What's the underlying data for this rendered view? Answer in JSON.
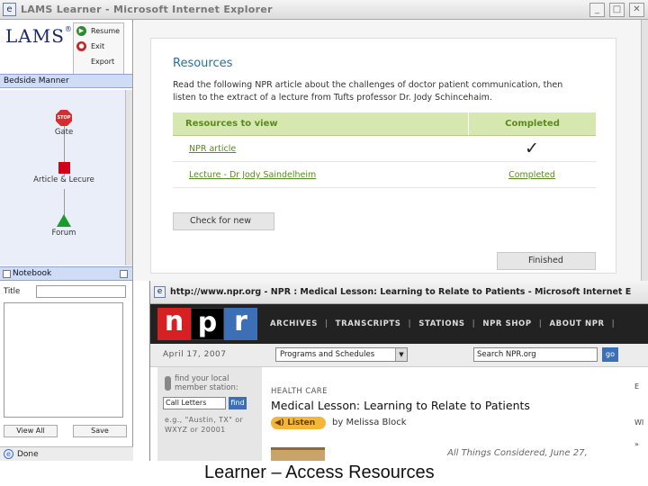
{
  "window": {
    "title": "LAMS Learner - Microsoft Internet Explorer"
  },
  "lams": {
    "logo": "LAMS",
    "controls": [
      "Resume",
      "Exit",
      "Export"
    ],
    "planner_label": "Bedside Manner",
    "activities": [
      "Gate",
      "Article & Lecure",
      "Forum"
    ],
    "gate_icon_text": "STOP",
    "notebook_label": "Notebook",
    "title_label": "Title",
    "buttons": [
      "View All",
      "Save"
    ]
  },
  "status": {
    "text": "Done"
  },
  "resources": {
    "title": "Resources",
    "description": "Read the following NPR article about the challenges of doctor patient communication, then listen to the extract of a lecture from Tufts professor Dr. Jody Schincehaim.",
    "col_resource": "Resources to view",
    "col_completed": "Completed",
    "rows": [
      {
        "name": "NPR article",
        "status": "✓"
      },
      {
        "name": "Lecture - Dr Jody Saindelheim",
        "status": "Completed"
      }
    ],
    "check_button": "Check for new",
    "finish_button": "Finished"
  },
  "npr": {
    "window_title": "http://www.npr.org - NPR : Medical Lesson: Learning to Relate to Patients - Microsoft Internet E",
    "logo": [
      "n",
      "p",
      "r"
    ],
    "nav": [
      "ARCHIVES",
      "TRANSCRIPTS",
      "STATIONS",
      "NPR SHOP",
      "ABOUT NPR"
    ],
    "nav_sep": "|",
    "date": "April 17, 2007",
    "programs_select": "Programs and Schedules",
    "search_placeholder": "Search NPR.org",
    "go": "go",
    "station_finder": "find your local member station:",
    "call_letters": "Call Letters",
    "find": "find",
    "example": "e.g., \"Austin, TX\" or WXYZ or 20001",
    "kicker": "HEALTH CARE",
    "headline": "Medical Lesson: Learning to Relate to Patients",
    "listen": "Listen",
    "byline": "by Melissa Block",
    "program": "All Things Considered, June 27,",
    "right_text": [
      "E",
      "WI",
      "»"
    ]
  },
  "caption": "Learner – Access Resources",
  "colors": {
    "npr_red": "#d62021",
    "npr_blue": "#3d6fb6",
    "res_green": "#5a8a1f",
    "lams_navy": "#1a2a6c"
  }
}
